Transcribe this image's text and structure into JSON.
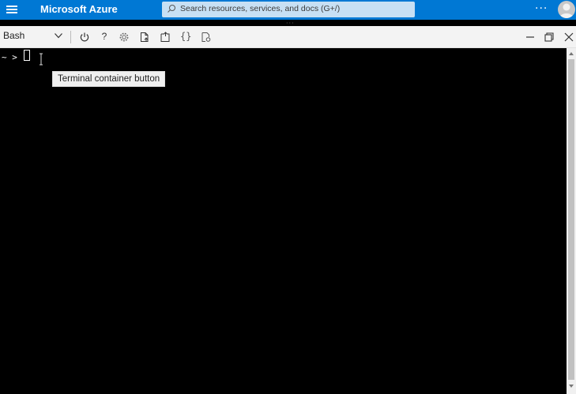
{
  "header": {
    "brand": "Microsoft Azure",
    "search_placeholder": "Search resources, services, and docs (G+/)",
    "more": "···"
  },
  "toolbar": {
    "shell": "Bash",
    "help": "?",
    "editor": "{}"
  },
  "terminal": {
    "prompt": "~ >",
    "tooltip": "Terminal container button"
  },
  "colors": {
    "header_bg": "#0078d4",
    "search_bg": "#c7e0f4",
    "toolbar_bg": "#f3f3f3",
    "terminal_bg": "#000000"
  }
}
